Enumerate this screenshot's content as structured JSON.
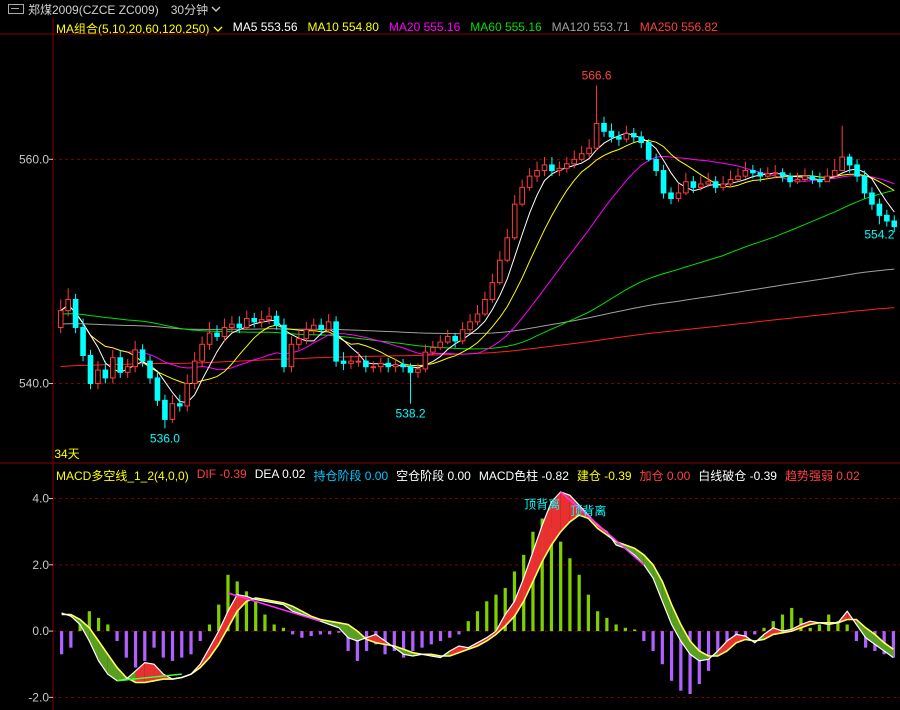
{
  "header": {
    "symbol_title": "郑煤2009(CZCE ZC009)",
    "period": "30分钟"
  },
  "ma_legend": {
    "label": "MA组合(5,10,20,60,120,250)",
    "items": [
      {
        "text": "MA5 553.56",
        "color": "#ffffff"
      },
      {
        "text": "MA10 554.80",
        "color": "#ffff00"
      },
      {
        "text": "MA20 555.16",
        "color": "#ff00ff"
      },
      {
        "text": "MA60 555.16",
        "color": "#00e000"
      },
      {
        "text": "MA120 553.71",
        "color": "#a0a0a0"
      },
      {
        "text": "MA250 556.82",
        "color": "#ff4040"
      }
    ]
  },
  "macd_legend": {
    "label": "MACD多空线_1_2(4,0,0)",
    "items": [
      {
        "text": "DIF -0.39",
        "color": "#ff4040"
      },
      {
        "text": "DEA 0.02",
        "color": "#ffffff"
      },
      {
        "text": "持仓阶段 0.00",
        "color": "#00c8ff"
      },
      {
        "text": "空仓阶段 0.00",
        "color": "#ffffff"
      },
      {
        "text": "MACD色柱 -0.82",
        "color": "#ffffff"
      },
      {
        "text": "建仓 -0.39",
        "color": "#ffff00"
      },
      {
        "text": "加仓 0.00",
        "color": "#ff4040"
      },
      {
        "text": "白线破仓 -0.39",
        "color": "#ffffff"
      },
      {
        "text": "趋势强弱 0.02",
        "color": "#ff4040"
      }
    ]
  },
  "colors": {
    "up": "#ff3b3b",
    "down": "#00ffff",
    "grid": "#7a0000",
    "ma5": "#ffffff",
    "ma10": "#ffff00",
    "ma20": "#ff00ff",
    "ma60": "#00e000",
    "ma120": "#a0a0a0",
    "ma250": "#ff2020"
  },
  "chart_data": [
    {
      "type": "candlestick",
      "title": "郑煤2009(CZCE ZC009) 30分钟",
      "ylim": [
        533,
        571
      ],
      "y_ticks": [
        {
          "value": 560,
          "label": "560.0"
        },
        {
          "value": 540,
          "label": "540.0"
        }
      ],
      "grid": true,
      "annotations": [
        {
          "text": "566.6",
          "value": 566.6,
          "bar_index": 72,
          "color": "#ff4040"
        },
        {
          "text": "536.0",
          "value": 536.0,
          "bar_index": 14,
          "color": "#00ffff"
        },
        {
          "text": "538.2",
          "value": 538.2,
          "bar_index": 47,
          "color": "#00ffff"
        },
        {
          "text": "554.2",
          "value": 554.2,
          "bar_index": 110,
          "color": "#00ffff"
        },
        {
          "text": "34天",
          "color": "#ffff00"
        }
      ],
      "close": [
        546.5,
        547.5,
        545.0,
        542.5,
        540.0,
        541.2,
        540.5,
        542.3,
        541.0,
        541.5,
        543.0,
        542.0,
        540.5,
        538.5,
        536.8,
        538.2,
        538.0,
        540.0,
        542.0,
        543.5,
        544.5,
        544.2,
        545.0,
        545.3,
        545.0,
        545.8,
        545.5,
        545.7,
        546.0,
        545.2,
        541.5,
        543.5,
        544.0,
        544.8,
        545.2,
        544.8,
        545.5,
        542.0,
        541.8,
        542.0,
        542.0,
        541.5,
        541.5,
        541.8,
        541.5,
        541.7,
        541.5,
        541.0,
        541.3,
        542.8,
        543.2,
        543.7,
        544.2,
        543.8,
        544.8,
        545.5,
        546.2,
        547.5,
        549.0,
        551.0,
        553.0,
        556.0,
        557.5,
        558.5,
        559.0,
        559.5,
        559.0,
        559.2,
        559.6,
        560.0,
        560.5,
        561.0,
        563.2,
        562.5,
        562.0,
        561.8,
        562.3,
        562.0,
        561.5,
        560.0,
        559.0,
        557.0,
        556.5,
        557.0,
        558.0,
        557.5,
        557.8,
        558.0,
        557.5,
        557.8,
        558.2,
        558.5,
        559.0,
        558.8,
        558.5,
        558.7,
        558.8,
        558.5,
        558.0,
        558.2,
        558.5,
        558.2,
        558.0,
        558.5,
        559.0,
        560.2,
        559.5,
        558.5,
        557.0,
        556.0,
        555.0,
        554.5,
        554.0
      ],
      "open": [
        545.0,
        546.5,
        547.5,
        545.0,
        542.5,
        540.0,
        541.2,
        540.5,
        542.3,
        541.0,
        541.5,
        543.0,
        542.0,
        540.5,
        538.5,
        536.8,
        538.2,
        538.0,
        540.0,
        542.0,
        543.5,
        544.5,
        544.2,
        545.0,
        545.3,
        545.0,
        545.8,
        545.5,
        545.7,
        546.0,
        545.2,
        541.5,
        543.5,
        544.0,
        544.8,
        545.2,
        544.8,
        545.5,
        542.0,
        541.8,
        542.0,
        542.0,
        541.5,
        541.5,
        541.8,
        541.5,
        541.7,
        541.5,
        541.0,
        541.3,
        542.8,
        543.2,
        543.7,
        544.2,
        543.8,
        544.8,
        545.5,
        546.2,
        547.5,
        549.0,
        551.0,
        553.0,
        556.0,
        557.5,
        558.5,
        559.0,
        559.5,
        559.0,
        559.2,
        559.6,
        560.0,
        560.5,
        561.0,
        563.2,
        562.5,
        562.0,
        561.8,
        562.3,
        562.0,
        561.5,
        560.0,
        559.0,
        557.0,
        556.5,
        557.0,
        558.0,
        557.5,
        557.8,
        558.0,
        557.5,
        557.8,
        558.2,
        558.5,
        559.0,
        558.8,
        558.5,
        558.7,
        558.8,
        558.5,
        558.0,
        558.2,
        558.5,
        558.2,
        558.0,
        558.5,
        559.0,
        560.2,
        559.5,
        558.5,
        557.0,
        556.0,
        555.0,
        554.5
      ],
      "high": [
        547.5,
        548.5,
        548.0,
        545.8,
        543.0,
        542.0,
        542.0,
        543.0,
        543.0,
        542.2,
        543.8,
        543.5,
        542.5,
        541.0,
        539.0,
        539.0,
        539.0,
        540.8,
        542.8,
        544.2,
        545.5,
        545.2,
        545.8,
        546.0,
        546.0,
        546.5,
        546.3,
        546.5,
        546.8,
        546.5,
        545.8,
        544.2,
        544.8,
        545.5,
        545.8,
        545.8,
        546.2,
        546.0,
        542.8,
        542.5,
        542.8,
        542.5,
        542.0,
        542.3,
        542.3,
        542.2,
        542.2,
        541.8,
        541.8,
        543.5,
        543.8,
        544.3,
        544.8,
        544.5,
        545.5,
        546.2,
        547.0,
        548.2,
        549.8,
        551.8,
        553.8,
        556.8,
        558.2,
        559.2,
        559.8,
        560.2,
        560.2,
        559.8,
        560.2,
        560.8,
        561.2,
        561.8,
        566.6,
        563.8,
        563.2,
        562.5,
        563.0,
        562.8,
        562.5,
        561.8,
        560.5,
        559.5,
        557.5,
        557.8,
        558.8,
        558.5,
        558.5,
        558.8,
        558.5,
        558.5,
        559.0,
        559.2,
        559.8,
        559.5,
        559.2,
        559.3,
        559.5,
        559.2,
        558.8,
        558.8,
        559.2,
        559.0,
        558.8,
        559.2,
        560.0,
        563.0,
        560.5,
        560.0,
        559.0,
        557.5,
        556.5,
        555.5,
        555.0
      ],
      "low": [
        544.5,
        546.0,
        544.5,
        542.0,
        539.5,
        539.5,
        540.0,
        540.0,
        540.5,
        540.5,
        541.0,
        541.5,
        540.0,
        538.0,
        536.0,
        536.5,
        537.5,
        537.5,
        539.5,
        541.5,
        543.0,
        543.8,
        543.8,
        544.5,
        544.5,
        544.8,
        545.0,
        545.0,
        545.3,
        544.8,
        541.0,
        541.0,
        543.0,
        543.5,
        544.3,
        544.3,
        544.5,
        541.5,
        541.2,
        541.3,
        541.5,
        541.0,
        541.0,
        541.0,
        541.0,
        541.0,
        541.0,
        538.2,
        540.5,
        541.0,
        542.5,
        543.0,
        543.5,
        543.2,
        543.5,
        544.5,
        545.2,
        546.0,
        547.2,
        548.8,
        550.8,
        552.8,
        555.8,
        557.2,
        558.0,
        558.5,
        558.5,
        558.5,
        558.8,
        559.2,
        559.8,
        560.2,
        560.8,
        562.0,
        561.5,
        561.2,
        561.5,
        561.5,
        561.0,
        559.8,
        558.5,
        556.5,
        556.0,
        556.2,
        556.8,
        557.0,
        557.2,
        557.5,
        557.0,
        557.2,
        557.5,
        558.0,
        558.3,
        558.3,
        558.0,
        558.2,
        558.3,
        558.0,
        557.5,
        557.8,
        558.0,
        557.8,
        557.5,
        558.0,
        558.5,
        559.0,
        558.8,
        558.0,
        556.5,
        555.5,
        554.2,
        554.0,
        553.5
      ]
    },
    {
      "type": "bar",
      "title": "MACD多空线_1_2(4,0,0)",
      "ylim": [
        -2.2,
        4.5
      ],
      "y_ticks": [
        {
          "value": 4.0,
          "label": "4.0"
        },
        {
          "value": 2.0,
          "label": "2.0"
        },
        {
          "value": 0.0,
          "label": "0.0"
        },
        {
          "value": -2.0,
          "label": "-2.0"
        }
      ],
      "annotations": [
        {
          "text": "顶背离",
          "value": 3.7,
          "bar_index": 52,
          "color": "#00ffff"
        },
        {
          "text": "顶背离",
          "value": 3.5,
          "bar_index": 57,
          "color": "#00ffff"
        }
      ],
      "series": [
        {
          "name": "DIF",
          "values": [
            0.55,
            0.45,
            0.2,
            -0.3,
            -0.9,
            -1.3,
            -1.5,
            -1.45,
            -1.2,
            -0.95,
            -1.0,
            -1.3,
            -1.45,
            -1.4,
            -1.3,
            -1.0,
            -0.5,
            0.0,
            0.6,
            1.1,
            1.05,
            0.95,
            0.9,
            0.85,
            0.8,
            0.6,
            0.5,
            0.4,
            0.3,
            0.2,
            0.1,
            -0.2,
            -0.3,
            -0.2,
            -0.1,
            -0.3,
            -0.5,
            -0.7,
            -0.75,
            -0.7,
            -0.75,
            -0.8,
            -0.6,
            -0.45,
            -0.5,
            -0.35,
            -0.2,
            0.0,
            0.5,
            0.9,
            1.6,
            2.4,
            3.2,
            3.9,
            4.2,
            4.1,
            3.8,
            3.5,
            3.2,
            3.0,
            2.6,
            2.5,
            2.3,
            2.0,
            1.6,
            0.9,
            0.2,
            -0.3,
            -0.7,
            -0.9,
            -0.85,
            -0.6,
            -0.3,
            -0.1,
            -0.15,
            -0.35,
            -0.1,
            0.1,
            0.0,
            0.05,
            0.2,
            0.3,
            0.25,
            0.2,
            0.25,
            0.6,
            0.2,
            -0.2,
            -0.4,
            -0.6,
            -0.8
          ]
        },
        {
          "name": "DEA",
          "values": [
            0.5,
            0.5,
            0.35,
            0.1,
            -0.3,
            -0.7,
            -1.1,
            -1.4,
            -1.55,
            -1.55,
            -1.5,
            -1.45,
            -1.45,
            -1.4,
            -1.3,
            -1.1,
            -0.8,
            -0.4,
            0.1,
            0.6,
            0.9,
            1.0,
            0.95,
            0.9,
            0.85,
            0.75,
            0.6,
            0.45,
            0.35,
            0.3,
            0.25,
            0.2,
            0.0,
            -0.25,
            -0.35,
            -0.4,
            -0.45,
            -0.55,
            -0.65,
            -0.7,
            -0.7,
            -0.75,
            -0.75,
            -0.65,
            -0.55,
            -0.45,
            -0.3,
            -0.1,
            0.15,
            0.45,
            0.9,
            1.5,
            2.1,
            2.6,
            3.0,
            3.3,
            3.5,
            3.4,
            3.1,
            2.9,
            2.7,
            2.6,
            2.5,
            2.3,
            2.0,
            1.5,
            0.8,
            0.2,
            -0.3,
            -0.6,
            -0.75,
            -0.75,
            -0.6,
            -0.35,
            -0.25,
            -0.3,
            -0.25,
            -0.1,
            -0.05,
            0.0,
            0.1,
            0.2,
            0.25,
            0.25,
            0.25,
            0.35,
            0.35,
            0.1,
            -0.1,
            -0.35,
            -0.55
          ]
        },
        {
          "name": "MACD色柱",
          "values": [
            -0.7,
            -0.5,
            0.3,
            0.6,
            0.4,
            0.2,
            -0.3,
            -0.8,
            -1.1,
            -0.9,
            -0.5,
            -0.8,
            -0.9,
            -0.8,
            -0.7,
            -0.3,
            0.2,
            0.8,
            1.7,
            1.5,
            1.2,
            0.9,
            0.5,
            0.2,
            0.1,
            -0.1,
            -0.2,
            -0.15,
            -0.1,
            -0.1,
            -0.05,
            -0.6,
            -0.9,
            -0.6,
            -0.4,
            -0.7,
            -0.6,
            -0.8,
            -0.6,
            -0.5,
            -0.4,
            -0.3,
            -0.2,
            -0.1,
            0.3,
            0.6,
            0.9,
            1.1,
            1.3,
            1.8,
            2.3,
            3.0,
            3.4,
            3.1,
            2.7,
            2.2,
            1.7,
            1.1,
            0.6,
            0.4,
            0.2,
            0.1,
            0.05,
            -0.3,
            -0.6,
            -1.0,
            -1.5,
            -1.8,
            -1.9,
            -1.6,
            -1.2,
            -0.7,
            -0.5,
            -0.3,
            -0.2,
            -0.1,
            0.1,
            0.3,
            0.5,
            0.7,
            0.4,
            0.1,
            0.2,
            0.5,
            0.3,
            0.2,
            -0.3,
            -0.5,
            -0.6,
            -0.7,
            -0.8
          ]
        }
      ]
    }
  ]
}
